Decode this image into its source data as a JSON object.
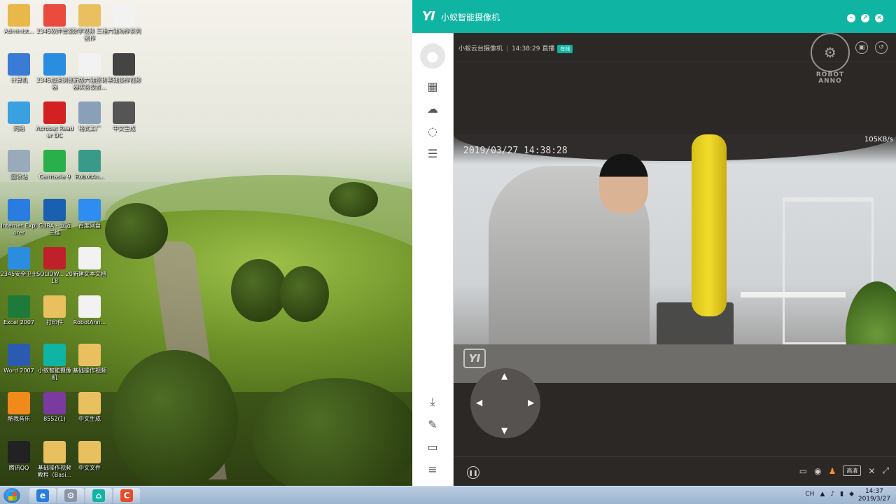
{
  "desktop": {
    "icons": [
      {
        "label": "Administ...",
        "icon": "folder-user-icon",
        "color": "#e8b84a"
      },
      {
        "label": "2345软件管家",
        "icon": "software-manager-icon",
        "color": "#e94b3c"
      },
      {
        "label": "数字视频 三维创作",
        "icon": "folder-video-icon",
        "color": "#e8c060"
      },
      {
        "label": "六轴动作系列",
        "icon": "text-file-icon",
        "color": "#f2f2f2"
      },
      {
        "label": "计算机",
        "icon": "computer-icon",
        "color": "#3a7bd5"
      },
      {
        "label": "2345加速浏览器",
        "icon": "browser-icon",
        "color": "#2a8de0"
      },
      {
        "label": "新版六轴控制器实验设置...",
        "icon": "text-file-icon",
        "color": "#f2f2f2"
      },
      {
        "label": "基础操作视频",
        "icon": "video-file-icon",
        "color": "#444"
      },
      {
        "label": "网络",
        "icon": "network-icon",
        "color": "#3aa0e0"
      },
      {
        "label": "Acrobat Reader DC",
        "icon": "pdf-icon",
        "color": "#d32020"
      },
      {
        "label": "格式工厂",
        "icon": "format-factory-icon",
        "color": "#8aa0b8"
      },
      {
        "label": "中文生成",
        "icon": "video-file-icon",
        "color": "#555"
      },
      {
        "label": "回收站",
        "icon": "recycle-bin-icon",
        "color": "#9ab"
      },
      {
        "label": "Camtasia 9",
        "icon": "camtasia-icon",
        "color": "#2ab04a"
      },
      {
        "label": "RobotAn...",
        "icon": "app-window-icon",
        "color": "#3a9a8a"
      },
      {
        "label": "Internet Explorer",
        "icon": "ie-icon",
        "color": "#2a7de0"
      },
      {
        "label": "CURA - 立迈三维",
        "icon": "cura-icon",
        "color": "#1a60b0"
      },
      {
        "label": "百度网盘",
        "icon": "cloud-drive-icon",
        "color": "#2f8cf0"
      },
      {
        "label": "2345安全卫士",
        "icon": "shield-icon",
        "color": "#2a8de0"
      },
      {
        "label": "SOLIDW... 2018",
        "icon": "solidworks-icon",
        "color": "#c0202a"
      },
      {
        "label": "新建文本文档",
        "icon": "text-file-icon",
        "color": "#f2f2f2"
      },
      {
        "label": "Excel 2007",
        "icon": "excel-icon",
        "color": "#1f7a3a"
      },
      {
        "label": "打印件",
        "icon": "folder-icon",
        "color": "#e8c060"
      },
      {
        "label": "RobotAnn...",
        "icon": "text-file-icon",
        "color": "#f2f2f2"
      },
      {
        "label": "Word 2007",
        "icon": "word-icon",
        "color": "#2a5bb0"
      },
      {
        "label": "小蚁智能摄像机",
        "icon": "yi-camera-icon",
        "color": "#10b4a3"
      },
      {
        "label": "基础操作视频",
        "icon": "folder-icon",
        "color": "#e8c060"
      },
      {
        "label": "酷我音乐",
        "icon": "music-icon",
        "color": "#f08a1a"
      },
      {
        "label": "8552(1)",
        "icon": "archive-icon",
        "color": "#7a3aa0"
      },
      {
        "label": "中文生成",
        "icon": "folder-icon",
        "color": "#e8c060"
      },
      {
        "label": "腾讯QQ",
        "icon": "qq-icon",
        "color": "#222"
      },
      {
        "label": "基础操作视频教程（Basi...",
        "icon": "folder-icon",
        "color": "#e8c060"
      },
      {
        "label": "中文文件",
        "icon": "folder-icon",
        "color": "#e8c060"
      }
    ]
  },
  "taskbar": {
    "items": [
      {
        "name": "ie-taskbar-icon",
        "glyph": "e",
        "color": "#2a7de0"
      },
      {
        "name": "settings-taskbar-icon",
        "glyph": "⚙",
        "color": "#8a96a6"
      },
      {
        "name": "yi-taskbar-icon",
        "glyph": "⌂",
        "color": "#10b4a3"
      },
      {
        "name": "camtasia-taskbar-icon",
        "glyph": "C",
        "color": "#e84a2a"
      }
    ],
    "tray_lang": "CH",
    "time": "14:37",
    "date": "2019/3/27"
  },
  "app": {
    "logo": "YI",
    "title": "小蚁智能摄像机",
    "window_buttons": [
      "–",
      "↗",
      "✕"
    ],
    "camera_name": "小蚁云台摄像机",
    "stream_time": "14:38:29 直播",
    "status_badge": "在线",
    "watermark_text": "ROBOT ANNO",
    "osd_date": "2019/03/27  14:38:28",
    "bitrate": "105KB/s",
    "osd_logo": "YI",
    "quality_label": "高清",
    "colors": {
      "accent": "#10b4a3",
      "background": "#2c2826",
      "warning": "#ff8a2a"
    }
  }
}
